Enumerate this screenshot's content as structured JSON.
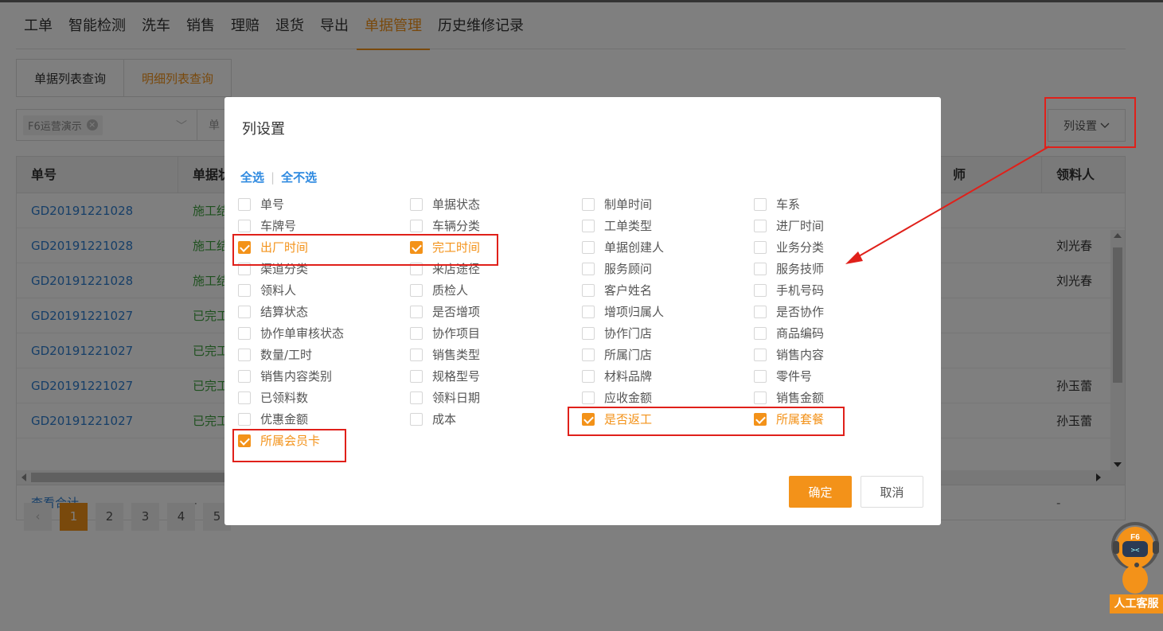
{
  "nav": [
    "工单",
    "智能检测",
    "洗车",
    "销售",
    "理赔",
    "退货",
    "导出",
    "单据管理",
    "历史维修记录"
  ],
  "nav_active": 7,
  "subtabs": [
    "单据列表查询",
    "明细列表查询"
  ],
  "filter": {
    "store_tag": "F6运营演示",
    "next_field": "单"
  },
  "column_settings_button": "列设置",
  "table": {
    "headers": [
      "单号",
      "单据状",
      "领料人"
    ],
    "header_mid_fragment": "师",
    "rows": [
      {
        "no": "GD20191221028",
        "status": "施工结",
        "picker": ""
      },
      {
        "no": "GD20191221028",
        "status": "施工结",
        "picker": "刘光春"
      },
      {
        "no": "GD20191221028",
        "status": "施工结",
        "picker": "刘光春"
      },
      {
        "no": "GD20191221027",
        "status": "已完工",
        "picker": ""
      },
      {
        "no": "GD20191221027",
        "status": "已完工",
        "picker": ""
      },
      {
        "no": "GD20191221027",
        "status": "已完工",
        "picker": "孙玉蕾"
      },
      {
        "no": "GD20191221027",
        "status": "已完工",
        "picker": "孙玉蕾"
      }
    ],
    "total_label": "查看合计",
    "total_dash": "-",
    "total_dash_right": "-"
  },
  "pagination": [
    "1",
    "2",
    "3",
    "4",
    "5"
  ],
  "modal": {
    "title": "列设置",
    "select_all": "全选",
    "select_none": "全不选",
    "separator": "|",
    "options": [
      {
        "label": "单号",
        "checked": false
      },
      {
        "label": "单据状态",
        "checked": false
      },
      {
        "label": "制单时间",
        "checked": false
      },
      {
        "label": "车系",
        "checked": false
      },
      {
        "label": "车牌号",
        "checked": false
      },
      {
        "label": "车辆分类",
        "checked": false
      },
      {
        "label": "工单类型",
        "checked": false
      },
      {
        "label": "进厂时间",
        "checked": false
      },
      {
        "label": "出厂时间",
        "checked": true
      },
      {
        "label": "完工时间",
        "checked": true
      },
      {
        "label": "单据创建人",
        "checked": false
      },
      {
        "label": "业务分类",
        "checked": false
      },
      {
        "label": "渠道分类",
        "checked": false
      },
      {
        "label": "来店途径",
        "checked": false
      },
      {
        "label": "服务顾问",
        "checked": false
      },
      {
        "label": "服务技师",
        "checked": false
      },
      {
        "label": "领料人",
        "checked": false
      },
      {
        "label": "质检人",
        "checked": false
      },
      {
        "label": "客户姓名",
        "checked": false
      },
      {
        "label": "手机号码",
        "checked": false
      },
      {
        "label": "结算状态",
        "checked": false
      },
      {
        "label": "是否增项",
        "checked": false
      },
      {
        "label": "增项归属人",
        "checked": false
      },
      {
        "label": "是否协作",
        "checked": false
      },
      {
        "label": "协作单审核状态",
        "checked": false
      },
      {
        "label": "协作项目",
        "checked": false
      },
      {
        "label": "协作门店",
        "checked": false
      },
      {
        "label": "商品编码",
        "checked": false
      },
      {
        "label": "数量/工时",
        "checked": false
      },
      {
        "label": "销售类型",
        "checked": false
      },
      {
        "label": "所属门店",
        "checked": false
      },
      {
        "label": "销售内容",
        "checked": false
      },
      {
        "label": "销售内容类别",
        "checked": false
      },
      {
        "label": "规格型号",
        "checked": false
      },
      {
        "label": "材料品牌",
        "checked": false
      },
      {
        "label": "零件号",
        "checked": false
      },
      {
        "label": "已领料数",
        "checked": false
      },
      {
        "label": "领料日期",
        "checked": false
      },
      {
        "label": "应收金额",
        "checked": false
      },
      {
        "label": "销售金额",
        "checked": false
      },
      {
        "label": "优惠金额",
        "checked": false
      },
      {
        "label": "成本",
        "checked": false
      },
      {
        "label": "是否返工",
        "checked": true
      },
      {
        "label": "所属套餐",
        "checked": true
      },
      {
        "label": "所属会员卡",
        "checked": true
      }
    ],
    "ok": "确定",
    "cancel": "取消"
  },
  "mascot": {
    "badge": "F6",
    "label": "人工客服"
  },
  "colors": {
    "accent": "#f39219",
    "link": "#2f7fd0",
    "annotation": "#e0201a"
  }
}
